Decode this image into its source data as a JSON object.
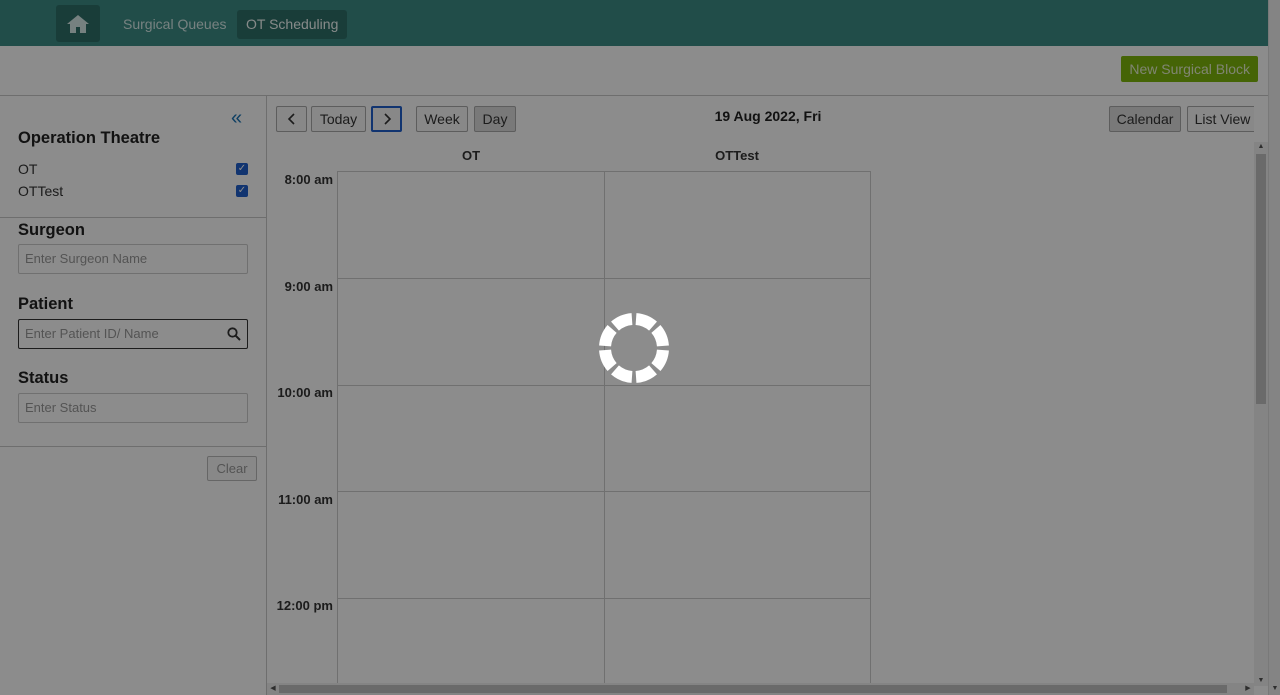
{
  "header": {
    "nav": [
      {
        "label": "Surgical Queues"
      },
      {
        "label": "OT Scheduling"
      }
    ]
  },
  "actions": {
    "new_block_label": "New Surgical Block"
  },
  "sidebar": {
    "operation_theatre_title": "Operation Theatre",
    "theatres": [
      {
        "label": "OT",
        "checked": true
      },
      {
        "label": "OTTest",
        "checked": true
      }
    ],
    "surgeon_title": "Surgeon",
    "surgeon_placeholder": "Enter Surgeon Name",
    "patient_title": "Patient",
    "patient_placeholder": "Enter Patient ID/ Name",
    "status_title": "Status",
    "status_placeholder": "Enter Status",
    "clear_label": "Clear"
  },
  "toolbar": {
    "today_label": "Today",
    "week_label": "Week",
    "day_label": "Day",
    "date_label": "19 Aug 2022, Fri",
    "calendar_label": "Calendar",
    "list_view_label": "List View",
    "active_view": "Day"
  },
  "calendar": {
    "columns": [
      "OT",
      "OTTest"
    ],
    "times": [
      "8:00 am",
      "9:00 am",
      "10:00 am",
      "11:00 am",
      "12:00 pm"
    ]
  },
  "loading": true,
  "colors": {
    "header": "#3c8d86",
    "accent_green": "#7fb60b",
    "link_blue": "#1a73b4"
  }
}
